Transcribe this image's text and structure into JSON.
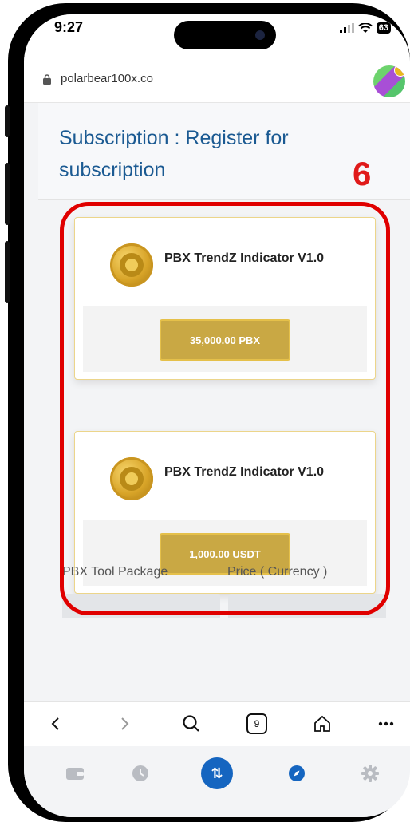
{
  "status_bar": {
    "time": "9:27",
    "battery": "63"
  },
  "browser": {
    "url": "polarbear100x.co"
  },
  "page": {
    "title": "Subscription : Register for subscription",
    "step_marker": "6"
  },
  "products": [
    {
      "name": "PBX TrendZ Indicator V1.0",
      "price": "35,000.00 PBX"
    },
    {
      "name": "PBX TrendZ Indicator V1.0",
      "price": "1,000.00 USDT"
    }
  ],
  "table": {
    "headers": [
      "PBX Tool Package",
      "Price ( Currency )"
    ]
  },
  "toolbar": {
    "tabs_count": "9"
  },
  "icons": {
    "back": "chevron-left-icon",
    "forward": "chevron-right-icon",
    "search": "search-icon",
    "tabs": "tabs-icon",
    "home": "home-icon",
    "more": "more-icon",
    "wallet": "wallet-icon",
    "history": "clock-icon",
    "swap": "swap-icon",
    "discover": "compass-icon",
    "settings": "gear-icon"
  },
  "colors": {
    "title_blue": "#1b5a92",
    "gold_button": "#c9a844",
    "highlight_red": "#e00000",
    "nav_blue": "#1565c0"
  }
}
